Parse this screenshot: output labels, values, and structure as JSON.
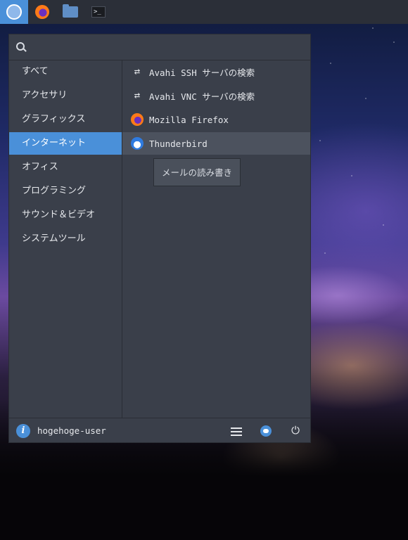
{
  "taskbar": {
    "items": [
      {
        "name": "applications-menu",
        "icon": "menu-logo-icon"
      },
      {
        "name": "firefox",
        "icon": "firefox-icon"
      },
      {
        "name": "file-manager",
        "icon": "folder-icon"
      },
      {
        "name": "terminal",
        "icon": "terminal-icon",
        "glyph": ">_"
      }
    ]
  },
  "search": {
    "placeholder": "",
    "value": ""
  },
  "categories": [
    {
      "label": "すべて",
      "selected": false
    },
    {
      "label": "アクセサリ",
      "selected": false
    },
    {
      "label": "グラフィックス",
      "selected": false
    },
    {
      "label": "インターネット",
      "selected": true
    },
    {
      "label": "オフィス",
      "selected": false
    },
    {
      "label": "プログラミング",
      "selected": false
    },
    {
      "label": "サウンド＆ビデオ",
      "selected": false
    },
    {
      "label": "システムツール",
      "selected": false
    }
  ],
  "apps": [
    {
      "label": "Avahi SSH サーバの検索",
      "icon": "swap-arrows-icon"
    },
    {
      "label": "Avahi VNC サーバの検索",
      "icon": "swap-arrows-icon"
    },
    {
      "label": "Mozilla Firefox",
      "icon": "firefox-icon"
    },
    {
      "label": "Thunderbird",
      "icon": "thunderbird-icon",
      "hover": true
    }
  ],
  "tooltip": {
    "text": "メールの読み書き"
  },
  "footer": {
    "username": "hogehoge-user",
    "icons": [
      "info-icon",
      "settings-icon",
      "toggle-icon",
      "power-icon"
    ]
  },
  "colors": {
    "accent": "#4a90d9",
    "panel": "#3a3f4a",
    "taskbar": "#2b2f38"
  }
}
